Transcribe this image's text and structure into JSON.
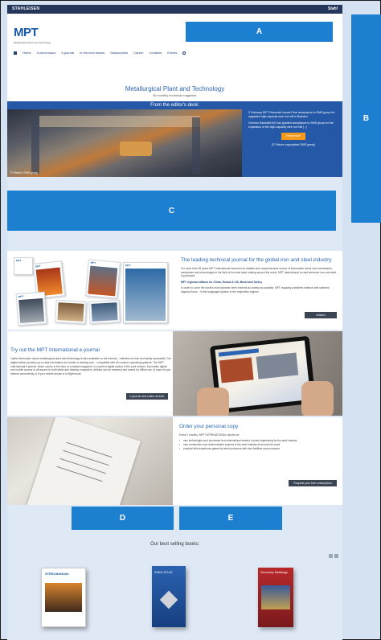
{
  "topbar": {
    "left_brand": "STAHLEISEN",
    "right_brand": "Stahl"
  },
  "logo": {
    "text": "MPT",
    "sub": "Metallurgical Plant and Technology"
  },
  "nav": [
    "Home",
    "Current issue",
    "e-journal",
    "In the next issues",
    "Subscription",
    "Career",
    "Contacts",
    "Events"
  ],
  "hero": {
    "title": "Metallurgical Plant and Technology",
    "subtitle": "Bi-monthly technical magazine"
  },
  "editors": {
    "label": "From the editor's desk:",
    "credit": "© Picture: SMS group",
    "news_1": "2 February MPT Recorded Issues Final acceptance to SMS group for upgraded high-capacity wire rod mill in Burbach",
    "news_2": "German Saarstahl AG has granted acceptance to SMS group for the expansion of the high-capacity wire rod mill [...]",
    "read_more": "Read more",
    "pic_credit": "(© Picture copyrighted SMS group)"
  },
  "row1": {
    "covers": [
      "MPT",
      "MPT",
      "MPT",
      "MPT",
      "MPT"
    ],
    "heading": "The leading technical journal for the global iron and steel industry",
    "p1": "For more than 35 years MPT International has been an reliable and comprehensive source of information about new investments, companies and technologies in the field of iron and steel making around the world. MPT International to read wherever iron and steel is produced.",
    "link": "MPT regional editions for China, Russia & CIS, Brazil and Turkey",
    "p2": "In order to cover the world's most dynamic steel markets as closely as possible, MPT regularly publishes editions with selected regional focus – in the languages spoken in the respective regions.",
    "button": "Articles"
  },
  "row2": {
    "heading": "Try out the MPT International e-journal",
    "body": "Latest information about metallurgical plant and technology is also available on the Internet – interference-free and easily accessible. Our digital edition provides up-to-date information for mobile or desktop use – compatible with all common operating systems. The MPT International e-journal, which comes in the form of a classic magazine, is a perfect digital replica of the print version. It provides digital and mobile access to all issues for both tablet and desktop computers. Articles can be retrieved and stored for offline use, in case of poor internet connectivity or if your mobile device is in flight mode.",
    "button": "e-journal and online archive"
  },
  "row3": {
    "heading": "Order your personal copy",
    "intro": "Every 2 months, MPT INTERNATIONAL reports on:",
    "bullets": [
      "new technologies and processes from international leaders in plant engineering for the steel industry",
      "new construction and modernization projects in the steel industry all around the world",
      "practical field experience gained by steel producers with their facilities and processes"
    ],
    "button": "Request your free subscription"
  },
  "books": {
    "title": "Our best selling books:",
    "b1": "STEELMANUAL",
    "b2": "STAHL ATLAS",
    "b3": "Secondary Metallurgy"
  },
  "overlays": {
    "a": "A",
    "b": "B",
    "c": "C",
    "d": "D",
    "e": "E"
  },
  "colors": {
    "label_blue": "#1d7fd0",
    "brand_blue": "#2559a7",
    "accent_orange": "#f39a1c"
  }
}
